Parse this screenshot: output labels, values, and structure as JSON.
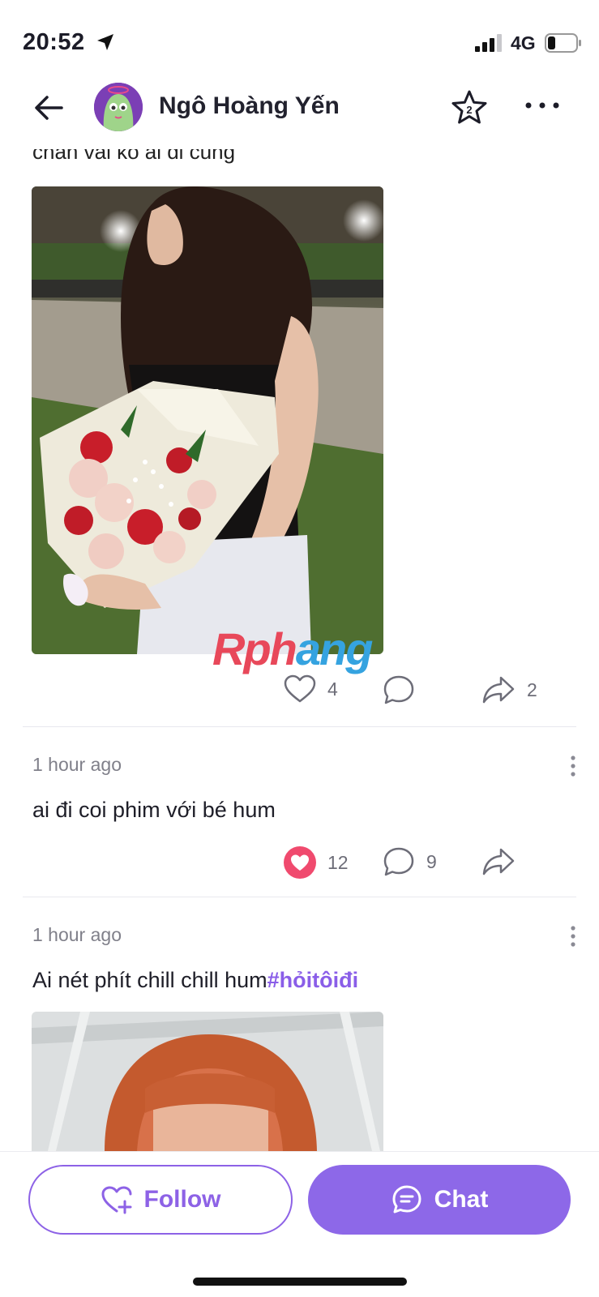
{
  "status_bar": {
    "time": "20:52",
    "network": "4G"
  },
  "header": {
    "name": "Ngô Hoàng Yến"
  },
  "posts": [
    {
      "text": "chán vãi ko ai đi cùng",
      "watermark": {
        "part1": "Rph",
        "part2": "ang"
      },
      "likes": "4",
      "comments": "",
      "shares": "2",
      "liked": false
    },
    {
      "timestamp": "1 hour ago",
      "text": "ai đi coi phim với bé hum",
      "likes": "12",
      "comments": "9",
      "shares": "",
      "liked": true
    },
    {
      "timestamp": "1 hour ago",
      "text": "Ai nét phít chill chill hum",
      "hashtag": "#hỏitôiđi"
    }
  ],
  "actions": {
    "follow_label": "Follow",
    "chat_label": "Chat"
  },
  "colors": {
    "accent": "#8d62e6",
    "like_active": "#f04a6e",
    "hashtag": "#8a5ee8"
  }
}
